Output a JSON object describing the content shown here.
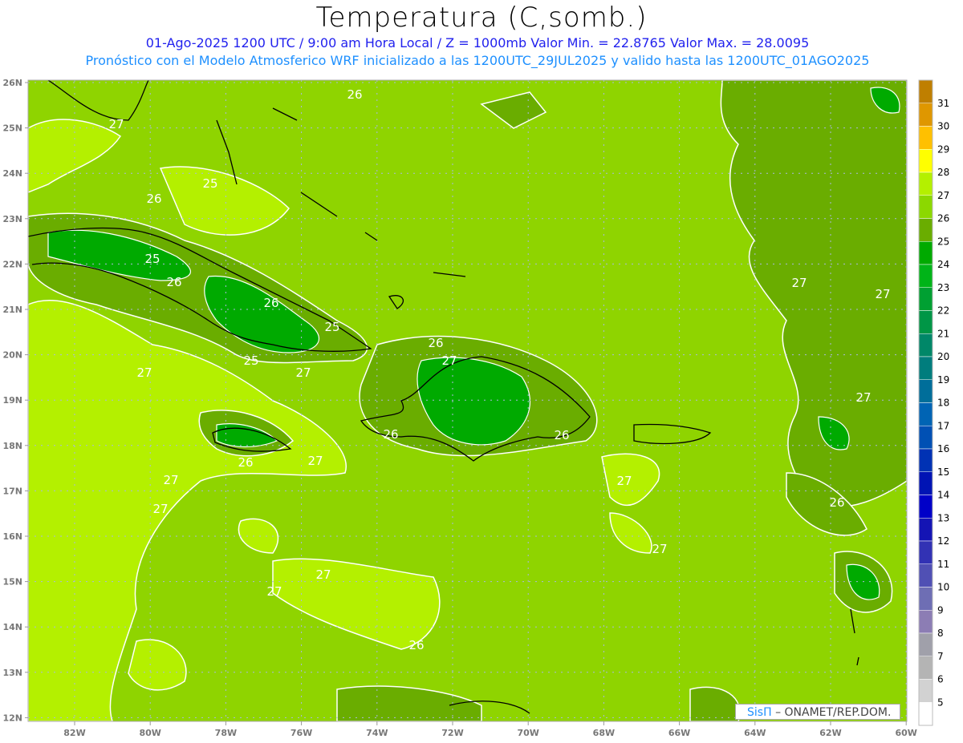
{
  "title": "Temperatura (C,somb.)",
  "subtitle_line1": "01-Ago-2025  1200 UTC / 9:00 am Hora Local / Z = 1000mb   Valor Min. = 22.8765  Valor Max. = 28.0095",
  "subtitle_line2": "Pronóstico con el Modelo Atmosferico WRF inicializado a las 1200UTC_29JUL2025 y valido hasta las  1200UTC_01AGO2025",
  "lat_labels": [
    "26N",
    "25N",
    "24N",
    "23N",
    "22N",
    "21N",
    "20N",
    "19N",
    "18N",
    "17N",
    "16N",
    "15N",
    "14N",
    "13N",
    "12N"
  ],
  "lon_labels": [
    "82W",
    "80W",
    "78W",
    "76W",
    "74W",
    "72W",
    "70W",
    "68W",
    "66W",
    "64W",
    "62W",
    "60W"
  ],
  "colorbar": {
    "labels": [
      "31",
      "30",
      "29",
      "28",
      "27",
      "26",
      "25",
      "24",
      "23",
      "22",
      "21",
      "20",
      "19",
      "18",
      "17",
      "16",
      "15",
      "14",
      "13",
      "12",
      "11",
      "10",
      "9",
      "8",
      "7",
      "6",
      "5"
    ],
    "colors": [
      "#bf7f00",
      "#df9700",
      "#ffc000",
      "#ffff00",
      "#b4f000",
      "#8cd800",
      "#6aad00",
      "#00aa00",
      "#00b418",
      "#00a032",
      "#009646",
      "#008768",
      "#007d7d",
      "#006e9a",
      "#0064b4",
      "#0050b4",
      "#0032b4",
      "#0014b4",
      "#0000c8",
      "#1414b4",
      "#3232b4",
      "#5050b4",
      "#6e6eb4",
      "#8c7db4",
      "#a0a0aa",
      "#b4b4b4",
      "#d2d2d2",
      "#ffffff"
    ]
  },
  "contour_labels": [
    "26",
    "27",
    "26",
    "25",
    "25",
    "26",
    "26",
    "25",
    "27",
    "25",
    "27",
    "26",
    "26",
    "27",
    "27",
    "27",
    "26",
    "26",
    "27",
    "27",
    "27",
    "27",
    "27",
    "27",
    "26",
    "27",
    "27",
    "26"
  ],
  "credit": {
    "logo_text": "SisΠ",
    "text": "–  ONAMET/REP.DOM."
  }
}
